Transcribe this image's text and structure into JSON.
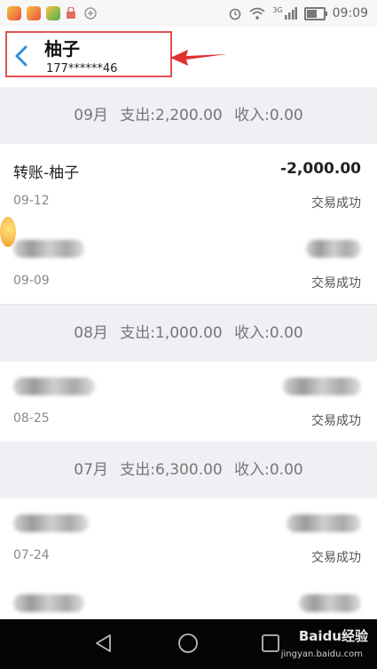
{
  "status_bar": {
    "time": "09:09",
    "network": "3G",
    "battery_level": 0.7
  },
  "header": {
    "title": "柚子",
    "subtitle": "177******46"
  },
  "sections": [
    {
      "month": "09月",
      "expense": "支出:2,200.00",
      "income": "收入:0.00"
    },
    {
      "month": "08月",
      "expense": "支出:1,000.00",
      "income": "收入:0.00"
    },
    {
      "month": "07月",
      "expense": "支出:6,300.00",
      "income": "收入:0.00"
    }
  ],
  "transactions": [
    {
      "title": "转账-柚子",
      "amount": "-2,000.00",
      "date": "09-12",
      "status": "交易成功"
    },
    {
      "title": "",
      "amount": "",
      "date": "09-09",
      "status": "交易成功"
    },
    {
      "title": "",
      "amount": "",
      "date": "08-25",
      "status": "交易成功"
    },
    {
      "title": "",
      "amount": "",
      "date": "07-24",
      "status": "交易成功"
    },
    {
      "title": "",
      "amount": "",
      "date": "",
      "status": ""
    }
  ],
  "watermark": {
    "brand": "Baidu经验",
    "url": "jingyan.baidu.com"
  }
}
